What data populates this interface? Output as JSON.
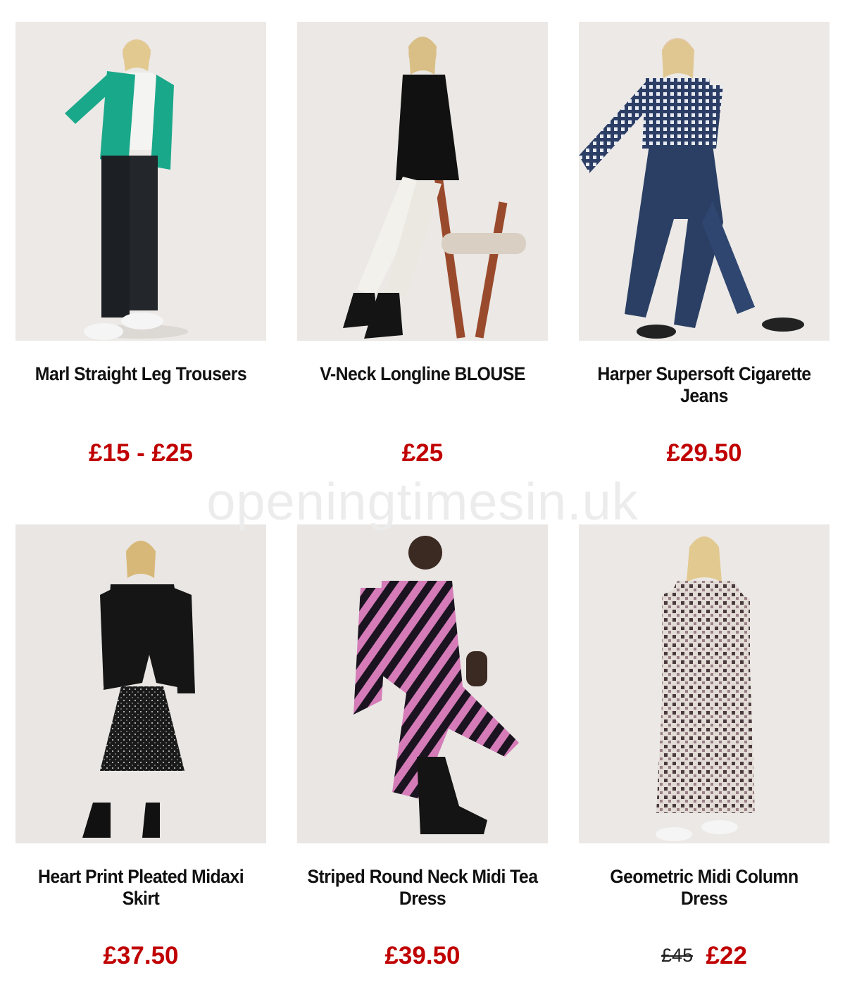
{
  "watermark": "openingtimesin.uk",
  "colors": {
    "price": "#c00000",
    "title": "#111111",
    "old_price": "#222222"
  },
  "products": [
    {
      "name": "Marl Straight Leg Trousers",
      "price": "£15 - £25",
      "old_price": ""
    },
    {
      "name": "V-Neck Longline BLOUSE",
      "price": "£25",
      "old_price": ""
    },
    {
      "name": "Harper Supersoft Cigarette Jeans",
      "price": "£29.50",
      "old_price": ""
    },
    {
      "name": "Heart Print Pleated Midaxi Skirt",
      "price": "£37.50",
      "old_price": ""
    },
    {
      "name": "Striped Round Neck Midi Tea Dress",
      "price": "£39.50",
      "old_price": ""
    },
    {
      "name": "Geometric Midi Column Dress",
      "price": "£22",
      "old_price": "£45"
    }
  ]
}
